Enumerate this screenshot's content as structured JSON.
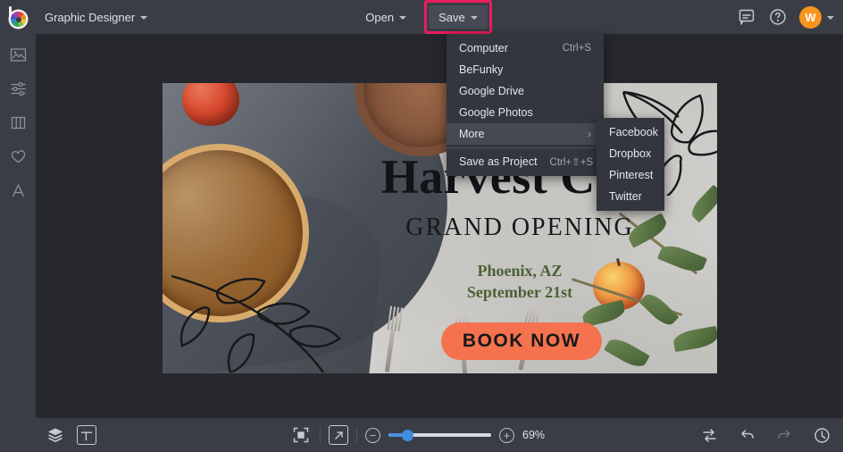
{
  "app": {
    "logo_icon": "befunky-logo-icon",
    "mode_label": "Graphic Designer"
  },
  "topbar": {
    "open_label": "Open",
    "save_label": "Save",
    "save_highlight_color": "#ea1d5d",
    "feedback_icon": "chat-bubble-icon",
    "help_icon": "help-circle-icon",
    "avatar_initial": "W",
    "avatar_color": "#f7941d"
  },
  "sidebar": {
    "items": [
      {
        "name": "image-manager",
        "icon": "image-icon"
      },
      {
        "name": "edit-adjust",
        "icon": "sliders-icon"
      },
      {
        "name": "templates",
        "icon": "columns-icon"
      },
      {
        "name": "favorites",
        "icon": "heart-icon"
      },
      {
        "name": "text",
        "icon": "text-a-icon"
      }
    ]
  },
  "save_menu": {
    "items": [
      {
        "label": "Computer",
        "shortcut": "Ctrl+S",
        "submenu": false,
        "active": false
      },
      {
        "label": "BeFunky",
        "shortcut": "",
        "submenu": false,
        "active": false
      },
      {
        "label": "Google Drive",
        "shortcut": "",
        "submenu": false,
        "active": false
      },
      {
        "label": "Google Photos",
        "shortcut": "",
        "submenu": false,
        "active": false
      },
      {
        "label": "More",
        "shortcut": "",
        "submenu": true,
        "active": true
      },
      {
        "label": "Save as Project",
        "shortcut": "Ctrl+⇧+S",
        "submenu": false,
        "active": false
      }
    ],
    "submenu_arrow": "chevron-right-icon",
    "submenu_items": [
      {
        "label": "Facebook"
      },
      {
        "label": "Dropbox"
      },
      {
        "label": "Pinterest"
      },
      {
        "label": "Twitter"
      }
    ]
  },
  "design": {
    "title": "Harvest Cafe",
    "subtitle": "GRAND OPENING",
    "location": "Phoenix, AZ",
    "date": "September 21st",
    "cta_label": "BOOK NOW",
    "cta_color": "#f4724d",
    "accent_text_color": "#4c6136"
  },
  "bottombar": {
    "layers_icon": "layers-icon",
    "layout_icon": "layout-panel-icon",
    "fit_icon": "fit-to-screen-icon",
    "expand_icon": "expand-arrow-icon",
    "zoom_out_label": "−",
    "zoom_in_label": "+",
    "zoom_value": "69%",
    "compare_icon": "compare-swap-icon",
    "undo_icon": "undo-arrow-icon",
    "redo_icon": "redo-arrow-icon",
    "history_icon": "history-clock-icon"
  }
}
